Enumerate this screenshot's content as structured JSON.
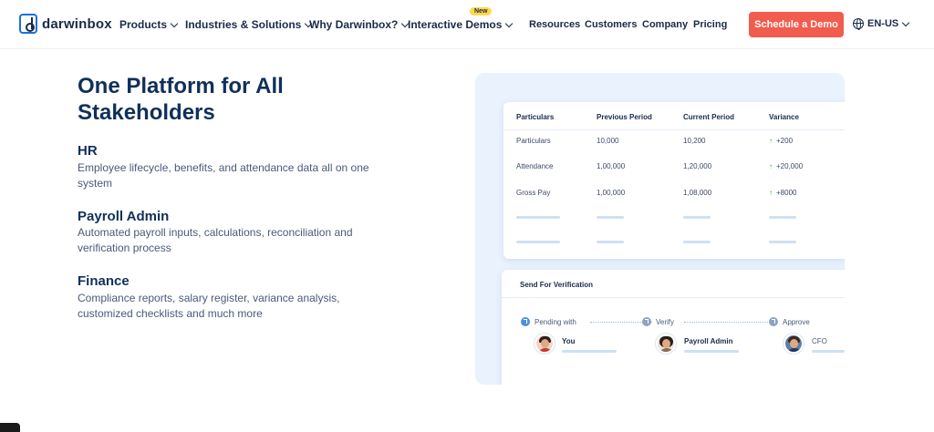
{
  "nav": {
    "logo_text": "darwinbox",
    "menu": [
      {
        "label": "Products"
      },
      {
        "label": "Industries & Solutions"
      },
      {
        "label": "Why Darwinbox?"
      },
      {
        "label": "Interactive Demos"
      }
    ],
    "new_badge": "New",
    "links": [
      "Resources",
      "Customers",
      "Company",
      "Pricing"
    ],
    "cta_label": "Schedule a Demo",
    "language": "EN-US",
    "icons": {
      "globe": "globe-icon",
      "chevron": "chevron-down-icon"
    }
  },
  "hero": {
    "headline": "One Platform for All Stakeholders",
    "sections": [
      {
        "title": "HR",
        "desc": "Employee lifecycle, benefits, and attendance data all on one system"
      },
      {
        "title": "Payroll Admin",
        "desc": "Automated payroll inputs, calculations, reconciliation and verification process"
      },
      {
        "title": "Finance",
        "desc": "Compliance reports, salary register, variance analysis, customized checklists and much more"
      }
    ]
  },
  "table": {
    "headers": [
      "Particulars",
      "Previous Period",
      "Current Period",
      "Variance"
    ],
    "rows": [
      {
        "particular": "Particulars",
        "previous": "10,000",
        "current": "10,200",
        "variance": "+200"
      },
      {
        "particular": "Attendance",
        "previous": "1,00,000",
        "current": "1,20,000",
        "variance": "+20,000"
      },
      {
        "particular": "Gross Pay",
        "previous": "1,00,000",
        "current": "1,08,000",
        "variance": "+8000"
      }
    ],
    "variance_arrow": "↑"
  },
  "verification": {
    "title": "Send For Verification",
    "steps": [
      "Pending with",
      "Verify",
      "Approve"
    ],
    "people": [
      "You",
      "Payroll Admin",
      "CFO"
    ]
  },
  "colors": {
    "primary_navy": "#10305a",
    "brand_blue": "#1e6fd9",
    "cta_red": "#f25c4e",
    "badge_yellow": "#ffd84d",
    "positive_green": "#1fae5b",
    "panel_bg": "#eaf3fd"
  }
}
